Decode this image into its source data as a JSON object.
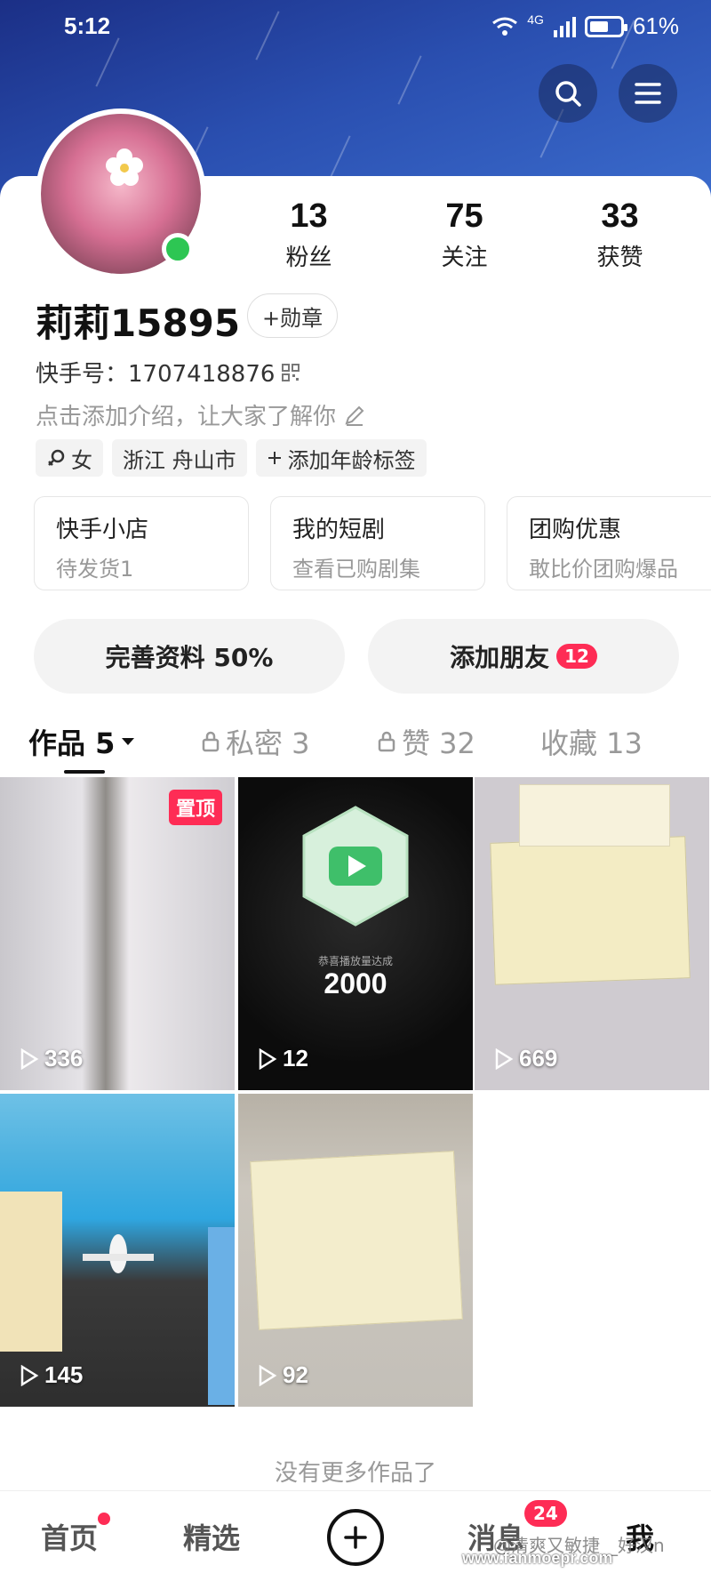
{
  "status_bar": {
    "time": "5:12",
    "network": "4G",
    "battery": "61%"
  },
  "header": {
    "search_icon": "search-icon",
    "menu_icon": "menu-icon"
  },
  "profile": {
    "name": "莉莉15895",
    "medal_label": "+勋章",
    "uid_label": "快手号：1707418876",
    "intro_placeholder": "点击添加介绍，让大家了解你",
    "tags": [
      "女",
      "浙江 舟山市",
      "添加年龄标签"
    ],
    "stats": [
      {
        "num": "13",
        "label": "粉丝"
      },
      {
        "num": "75",
        "label": "关注"
      },
      {
        "num": "33",
        "label": "获赞"
      }
    ]
  },
  "services": [
    {
      "title": "快手小店",
      "sub": "待发货1"
    },
    {
      "title": "我的短剧",
      "sub": "查看已购剧集"
    },
    {
      "title": "团购优惠",
      "sub": "敢比价团购爆品"
    }
  ],
  "actions": {
    "complete_profile": "完善资料 50%",
    "add_friends": "添加朋友",
    "add_friends_badge": "12"
  },
  "tabs": [
    {
      "label": "作品 5"
    },
    {
      "label": "私密 3"
    },
    {
      "label": "赞 32"
    },
    {
      "label": "收藏 13"
    }
  ],
  "posts": [
    {
      "plays": "336",
      "pinned": "置顶"
    },
    {
      "plays": "12",
      "overlay_title": "恭喜播放量达成",
      "overlay_num": "2000"
    },
    {
      "plays": "669"
    },
    {
      "plays": "145"
    },
    {
      "plays": "92"
    }
  ],
  "no_more": "没有更多作品了",
  "bottom_nav": {
    "home": "首页",
    "featured": "精选",
    "messages": "消息",
    "messages_badge": "24",
    "me": "我"
  },
  "watermark": {
    "line1": "@清爽又敏捷__好汉n",
    "line2": "www.fanmoepr.com"
  }
}
